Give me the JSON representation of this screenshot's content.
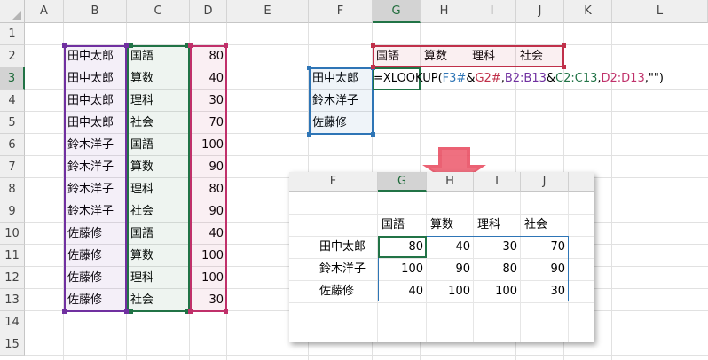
{
  "columns": [
    "A",
    "B",
    "C",
    "D",
    "E",
    "F",
    "G",
    "H",
    "I",
    "J",
    "K",
    "L"
  ],
  "rows": [
    "1",
    "2",
    "3",
    "4",
    "5",
    "6",
    "7",
    "8",
    "9",
    "10",
    "11",
    "12",
    "13",
    "14",
    "15"
  ],
  "selected_column": "G",
  "selected_row": "3",
  "names": [
    "田中太郎",
    "田中太郎",
    "田中太郎",
    "田中太郎",
    "鈴木洋子",
    "鈴木洋子",
    "鈴木洋子",
    "鈴木洋子",
    "佐藤修",
    "佐藤修",
    "佐藤修",
    "佐藤修"
  ],
  "subjects": [
    "国語",
    "算数",
    "理科",
    "社会",
    "国語",
    "算数",
    "理科",
    "社会",
    "国語",
    "算数",
    "理科",
    "社会"
  ],
  "scores": [
    "80",
    "40",
    "30",
    "70",
    "100",
    "90",
    "80",
    "90",
    "40",
    "100",
    "100",
    "30"
  ],
  "header_subjects": [
    "国語",
    "算数",
    "理科",
    "社会"
  ],
  "lookup_names": [
    "田中太郎",
    "鈴木洋子",
    "佐藤修"
  ],
  "formula": {
    "prefix": "=XLOOKUP(",
    "arg1": "F3#",
    "amp1": "&",
    "arg2": "G2#",
    "comma1": ",",
    "arg3": "B2:B13",
    "amp2": "&",
    "arg4": "C2:C13",
    "comma2": ",",
    "arg5": "D2:D13",
    "suffix": ",\"\")"
  },
  "inset": {
    "columns": [
      "F",
      "G",
      "H",
      "I",
      "J"
    ],
    "selected_column": "G",
    "header_subjects": [
      "国語",
      "算数",
      "理科",
      "社会"
    ],
    "names": [
      "田中太郎",
      "鈴木洋子",
      "佐藤修"
    ],
    "values": [
      [
        "80",
        "40",
        "30",
        "70"
      ],
      [
        "100",
        "90",
        "80",
        "90"
      ],
      [
        "40",
        "100",
        "100",
        "30"
      ]
    ]
  },
  "colors": {
    "names_range": "#7030a0",
    "subjects_range": "#217346",
    "scores_range": "#c0306a",
    "lookup_names_range": "#2e75b6",
    "header_range": "#c0304a",
    "arrow": "#e8455a"
  }
}
